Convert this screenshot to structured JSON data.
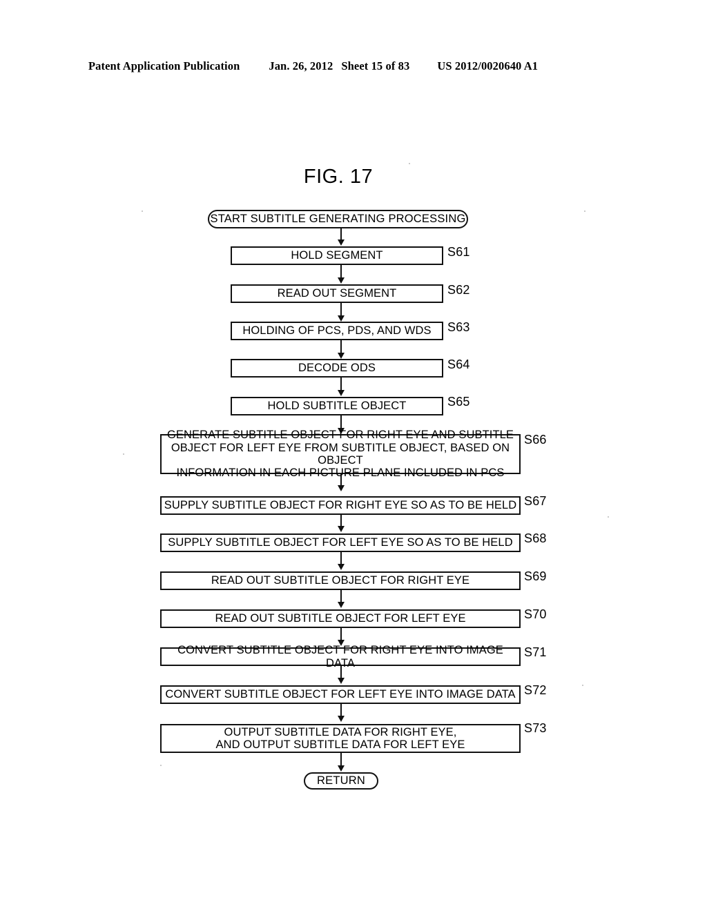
{
  "header": {
    "publication": "Patent Application Publication",
    "date": "Jan. 26, 2012",
    "sheet": "Sheet 15 of 83",
    "document_number": "US 2012/0020640 A1"
  },
  "figure": {
    "title": "FIG. 17"
  },
  "chart_data": {
    "type": "diagram",
    "title": "FIG. 17",
    "diagram_kind": "flowchart",
    "start_terminal": "START SUBTITLE GENERATING PROCESSING",
    "end_terminal": "RETURN",
    "steps": [
      {
        "id": "S61",
        "label": "HOLD SEGMENT",
        "width": "narrow",
        "lines": 1
      },
      {
        "id": "S62",
        "label": "READ OUT SEGMENT",
        "width": "narrow",
        "lines": 1
      },
      {
        "id": "S63",
        "label": "HOLDING OF PCS, PDS, AND WDS",
        "width": "narrow",
        "lines": 1
      },
      {
        "id": "S64",
        "label": "DECODE ODS",
        "width": "narrow",
        "lines": 1
      },
      {
        "id": "S65",
        "label": "HOLD SUBTITLE OBJECT",
        "width": "narrow",
        "lines": 1
      },
      {
        "id": "S66",
        "label": "GENERATE SUBTITLE OBJECT FOR RIGHT EYE AND SUBTITLE\nOBJECT FOR LEFT EYE FROM SUBTITLE OBJECT, BASED ON OBJECT\nINFORMATION IN EACH PICTURE PLANE INCLUDED IN PCS",
        "width": "wide",
        "lines": 3
      },
      {
        "id": "S67",
        "label": "SUPPLY SUBTITLE OBJECT FOR RIGHT EYE SO AS TO BE HELD",
        "width": "wide",
        "lines": 1
      },
      {
        "id": "S68",
        "label": "SUPPLY SUBTITLE OBJECT FOR LEFT EYE SO AS TO BE HELD",
        "width": "wide",
        "lines": 1
      },
      {
        "id": "S69",
        "label": "READ OUT SUBTITLE OBJECT FOR RIGHT EYE",
        "width": "wide",
        "lines": 1
      },
      {
        "id": "S70",
        "label": "READ OUT SUBTITLE OBJECT FOR LEFT EYE",
        "width": "wide",
        "lines": 1
      },
      {
        "id": "S71",
        "label": "CONVERT SUBTITLE OBJECT FOR RIGHT EYE INTO IMAGE DATA",
        "width": "wide",
        "lines": 1
      },
      {
        "id": "S72",
        "label": "CONVERT SUBTITLE OBJECT FOR LEFT EYE INTO IMAGE DATA",
        "width": "wide",
        "lines": 1
      },
      {
        "id": "S73",
        "label": "OUTPUT SUBTITLE DATA FOR RIGHT EYE,\nAND OUTPUT SUBTITLE DATA FOR LEFT EYE",
        "width": "wide",
        "lines": 2
      }
    ],
    "flow": "sequential top-to-bottom, single path from start terminal through S61..S73 to RETURN",
    "colors": {
      "ink": "#111111",
      "paper": "#ffffff"
    }
  }
}
